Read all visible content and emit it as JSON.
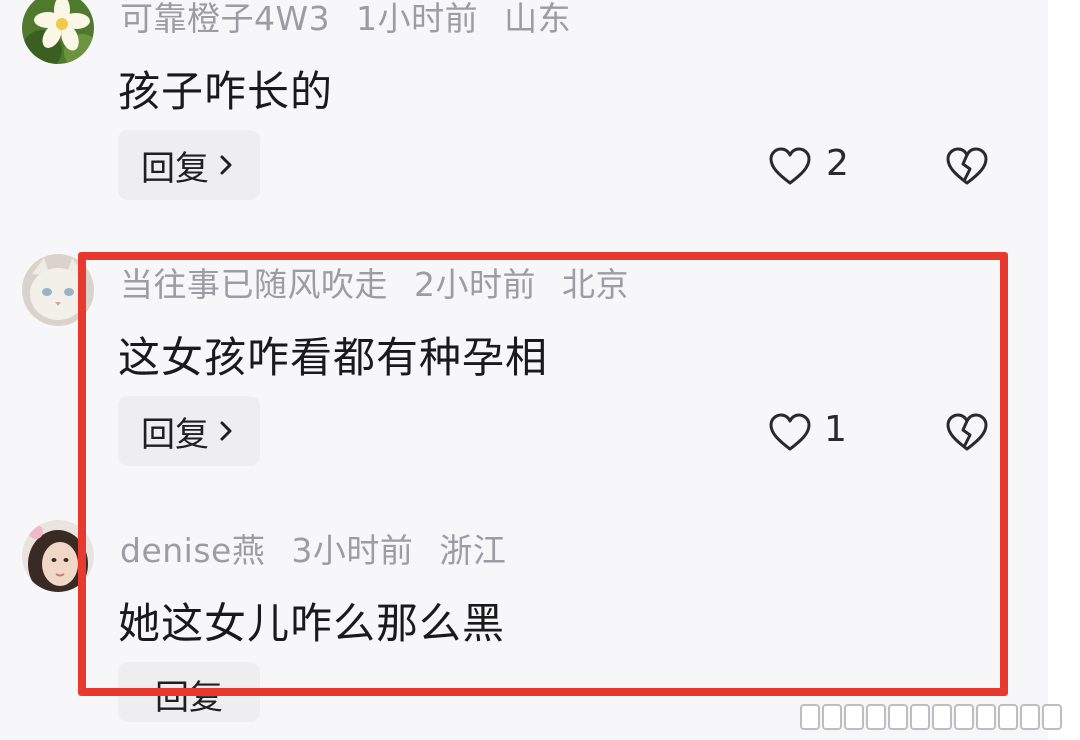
{
  "comments": [
    {
      "username": "可靠橙子4W3",
      "time": "1小时前",
      "location": "山东",
      "text": "孩子咋长的",
      "reply_label": "回复",
      "likes": "2",
      "avatar": "flower-avatar"
    },
    {
      "username": "当往事已随风吹走",
      "time": "2小时前",
      "location": "北京",
      "text": "这女孩咋看都有种孕相",
      "reply_label": "回复",
      "likes": "1",
      "avatar": "cat-avatar"
    },
    {
      "username": "denise燕",
      "time": "3小时前",
      "location": "浙江",
      "text": "她这女儿咋么那么黑",
      "reply_label": "回复",
      "avatar": "girl-avatar"
    }
  ],
  "colors": {
    "highlight": "#e8392f",
    "meta_text": "#9c9ca2",
    "body_text": "#1a1a1a"
  },
  "icons": {
    "like": "heart-outline-icon",
    "dislike": "broken-heart-icon",
    "reply_chevron": "chevron-right-icon"
  }
}
